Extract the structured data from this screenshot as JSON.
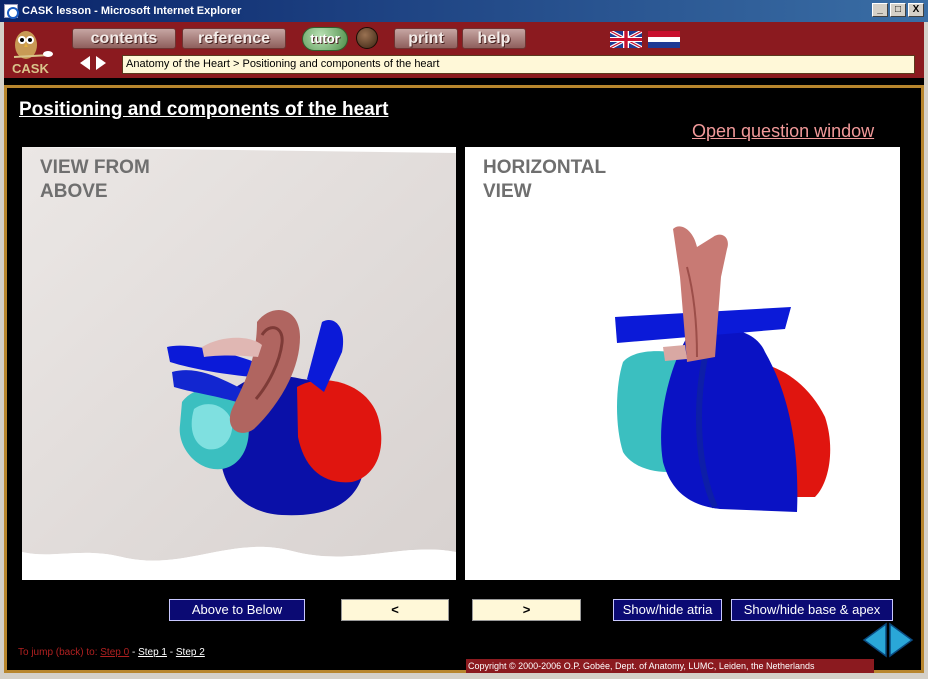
{
  "window": {
    "title": "CASK lesson - Microsoft Internet Explorer",
    "min": "_",
    "max": "□",
    "close": "X"
  },
  "toolbar": {
    "logo_text": "CASK",
    "contents": "contents",
    "reference": "reference",
    "tutor": "tutor",
    "print": "print",
    "help": "help",
    "breadcrumb": "Anatomy of the Heart > Positioning and components of the heart"
  },
  "page": {
    "title": "Positioning and components of the heart",
    "open_question": "Open question window"
  },
  "panels": {
    "left_label": "VIEW FROM ABOVE",
    "right_label": "HORIZONTAL VIEW"
  },
  "controls": {
    "above_below": "Above to Below",
    "prev": "<",
    "next": ">",
    "show_atria": "Show/hide atria",
    "show_base": "Show/hide base & apex"
  },
  "jump": {
    "prefix": "To jump (back) to:",
    "step0": "Step 0",
    "step1": "Step 1",
    "step2": "Step 2",
    "sep": " - "
  },
  "footer": {
    "copyright": "Copyright © 2000-2006 O.P. Gobée, Dept. of Anatomy, LUMC, Leiden, the Netherlands"
  },
  "colors": {
    "bar_red": "#8b1a1f",
    "frame_gold": "#b8862d",
    "button_blue": "#0b0a73",
    "heart_blue": "#0a10c8",
    "heart_red": "#e01a12",
    "heart_cyan": "#3bbfc0",
    "heart_pink": "#d0706a"
  }
}
